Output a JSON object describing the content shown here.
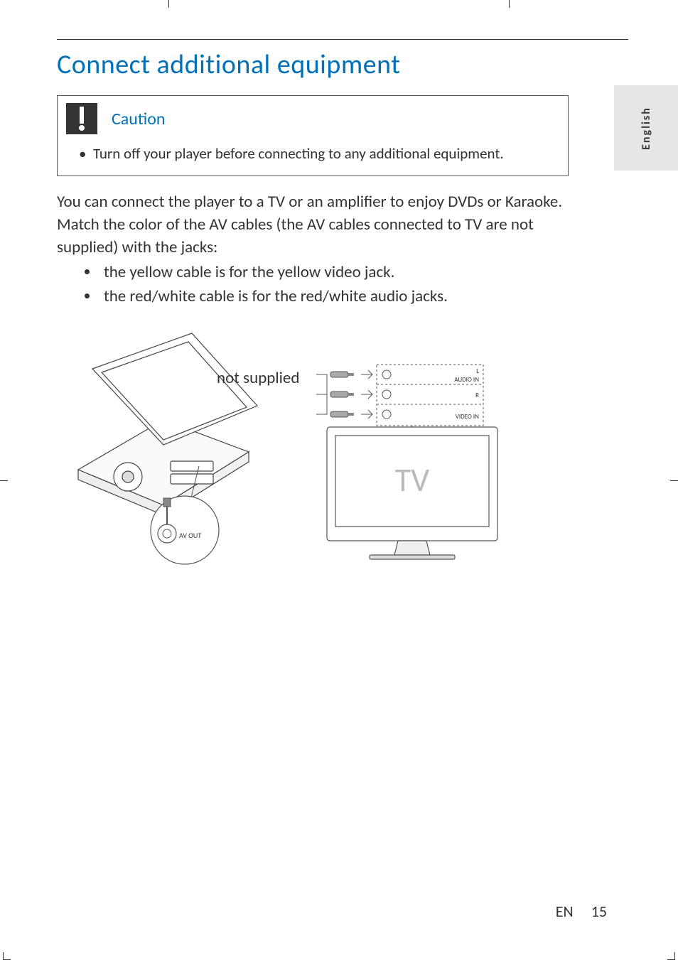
{
  "language_tab": "English",
  "section": {
    "title": "Connect additional equipment",
    "caution": {
      "label": "Caution",
      "items": [
        "Turn off your player before connecting to any additional equipment."
      ]
    },
    "paragraphs": [
      "You can connect the player to a TV or an amplifier to enjoy DVDs or Karaoke.",
      "Match the color of the AV cables (the AV cables connected to TV are not supplied) with the jacks:"
    ],
    "bullets": [
      "the yellow cable is for the yellow video jack.",
      "the red/white cable is for the red/white audio jacks."
    ],
    "figure": {
      "not_supplied_label": "not supplied",
      "av_out_label": "AV OUT",
      "tv_label": "TV",
      "inputs": {
        "audio_in": "AUDIO IN",
        "l": "L",
        "r": "R",
        "video_in": "VIDEO IN"
      }
    }
  },
  "footer": {
    "lang": "EN",
    "page": "15"
  }
}
